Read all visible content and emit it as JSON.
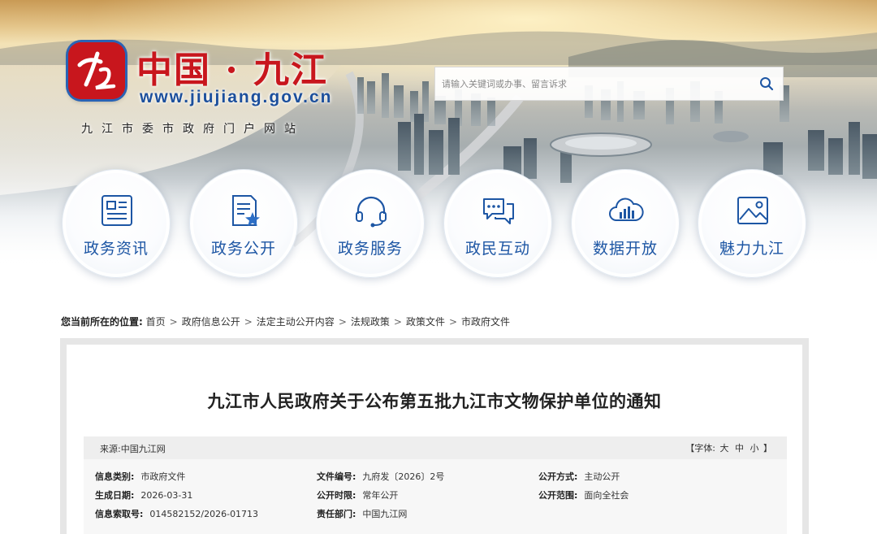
{
  "site": {
    "logo_cn": "中国 · 九江",
    "logo_url": "www.jiujiang.gov.cn",
    "logo_sub": "九江市委市政府门户网站"
  },
  "search": {
    "placeholder": "请输入关键词或办事、留言诉求",
    "icon": "search-icon"
  },
  "nav": {
    "items": [
      {
        "label": "政务资讯",
        "icon": "news-icon"
      },
      {
        "label": "政务公开",
        "icon": "document-star-icon"
      },
      {
        "label": "政务服务",
        "icon": "headset-icon"
      },
      {
        "label": "政民互动",
        "icon": "chat-bubbles-icon"
      },
      {
        "label": "数据开放",
        "icon": "cloud-data-icon"
      },
      {
        "label": "魅力九江",
        "icon": "picture-icon"
      }
    ]
  },
  "breadcrumb": {
    "label": "您当前所在的位置:",
    "sep": ">",
    "items": [
      "首页",
      "政府信息公开",
      "法定主动公开内容",
      "法规政策",
      "政策文件",
      "市政府文件"
    ]
  },
  "article": {
    "title": "九江市人民政府关于公布第五批九江市文物保护单位的通知",
    "source": "来源:中国九江网",
    "font_label": "【字体:",
    "font_options": [
      "大",
      "中",
      "小"
    ],
    "font_close": "】",
    "meta": [
      {
        "key": "信息类别:",
        "value": "市政府文件"
      },
      {
        "key": "文件编号:",
        "value": "九府发〔2026〕2号"
      },
      {
        "key": "公开方式:",
        "value": "主动公开"
      },
      {
        "key": "生成日期:",
        "value": "2026-03-31"
      },
      {
        "key": "公开时限:",
        "value": "常年公开"
      },
      {
        "key": "公开范围:",
        "value": "面向全社会"
      },
      {
        "key": "信息索取号:",
        "value": "014582152/2026-01713"
      },
      {
        "key": "责任部门:",
        "value": "中国九江网"
      }
    ]
  },
  "colors": {
    "brand_red": "#c8161d",
    "brand_blue": "#1d56a4",
    "url_blue": "#1c4f9c"
  }
}
